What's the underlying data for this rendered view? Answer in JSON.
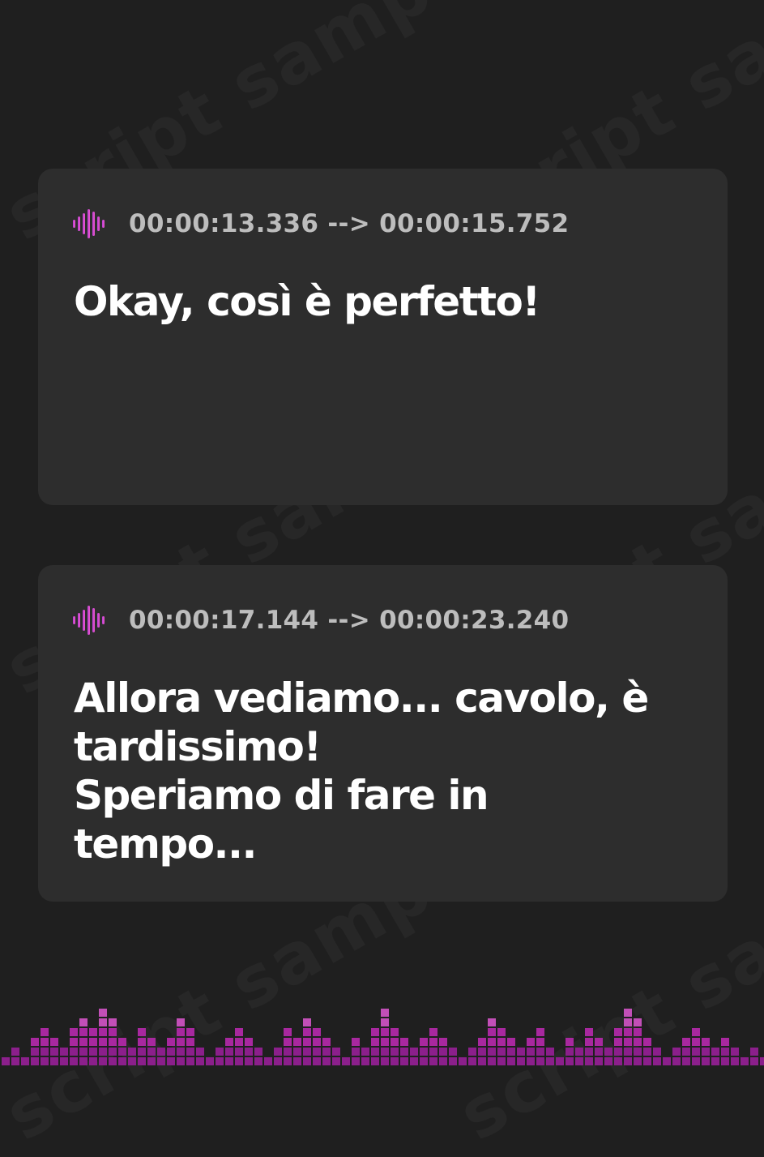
{
  "watermark": {
    "text": "script sample"
  },
  "subtitles": [
    {
      "timestamp": "00:00:13.336 --> 00:00:15.752",
      "text": "Okay, così è perfetto!"
    },
    {
      "timestamp": "00:00:17.144 --> 00:00:23.240",
      "text": "Allora vediamo... cavolo, è\ntardissimo!\nSperiamo di fare in\ntempo..."
    }
  ],
  "icons": {
    "timestamp_icon": "audio-wave-icon"
  },
  "colors": {
    "background": "#1f1f1f",
    "card": "#2d2d2d",
    "accent_pink": "#e24ccf",
    "accent_purple": "#8b1f8b",
    "timestamp_text": "#bdbdbd",
    "caption_text": "#ffffff"
  }
}
